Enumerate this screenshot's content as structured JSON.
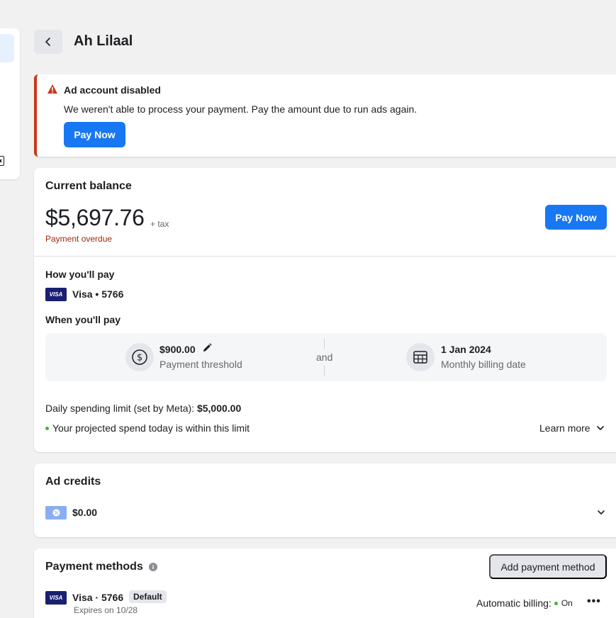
{
  "header": {
    "title": "Ah Lilaal"
  },
  "alert": {
    "title": "Ad account disabled",
    "message": "We weren't able to process your payment. Pay the amount due to run ads again.",
    "button": "Pay Now"
  },
  "balance": {
    "title": "Current balance",
    "amount": "$5,697.76",
    "tax_note": "+ tax",
    "status": "Payment overdue",
    "button": "Pay Now",
    "how_title": "How you'll pay",
    "card_label": "Visa • 5766",
    "when_title": "When you'll pay",
    "threshold_value": "$900.00",
    "threshold_label": "Payment threshold",
    "and_label": "and",
    "billing_date_value": "1 Jan 2024",
    "billing_date_label": "Monthly billing date",
    "limit_prefix": "Daily spending limit (set by Meta): ",
    "limit_value": "$5,000.00",
    "projected": "Your projected spend today is within this limit",
    "learn_more": "Learn more"
  },
  "credits": {
    "title": "Ad credits",
    "value": "$0.00"
  },
  "methods": {
    "title": "Payment methods",
    "add_button": "Add payment method",
    "card_label": "Visa · 5766",
    "default_badge": "Default",
    "expires": "Expires on 10/28",
    "auto_billing_label": "Automatic billing:",
    "auto_billing_state": "On",
    "more": "•••"
  },
  "brand": {
    "visa_text": "VISA"
  },
  "colors": {
    "primary": "#1877f2",
    "alert": "#c8381b",
    "overdue": "#a3290b",
    "success": "#42b72a"
  }
}
